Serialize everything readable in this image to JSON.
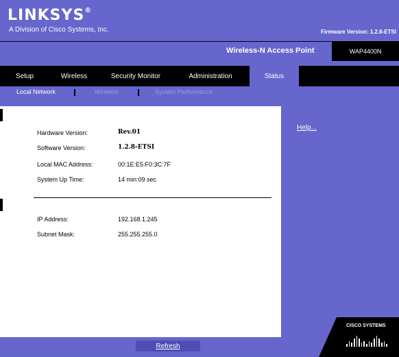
{
  "brand": {
    "name": "LINKSYS",
    "registered": "®",
    "tagline": "A Division of Cisco Systems, Inc."
  },
  "firmware": "Firmware Version: 1.2.8-ETSI",
  "product_name": "Wireless-N Access Point",
  "model": "WAP4400N",
  "tabs": [
    {
      "label": "Setup"
    },
    {
      "label": "Wireless"
    },
    {
      "label": "Security Monitor"
    },
    {
      "label": "Administration"
    },
    {
      "label": "Status"
    }
  ],
  "subtabs": [
    {
      "label": "Local Network"
    },
    {
      "label": "Wireless"
    },
    {
      "label": "System Performance"
    }
  ],
  "info": {
    "hardware_label": "Hardware Version:",
    "hardware_value": "Rev.01",
    "software_label": "Software Version:",
    "software_value": "1.2.8-ETSI",
    "mac_label": "Local MAC Address:",
    "mac_value": "00:1E:E5:F0:3C:7F",
    "uptime_label": "System Up Time:",
    "uptime_value": "14 min:09 sec",
    "ip_label": "IP Address:",
    "ip_value": "192.168.1.245",
    "mask_label": "Subnet Mask:",
    "mask_value": "255.255.255.0"
  },
  "help_link": "Help...",
  "refresh_button": "Refresh",
  "cisco_logo": "CISCO SYSTEMS",
  "colors": {
    "brand_purple": "#6666cc",
    "black": "#000000",
    "white": "#ffffff"
  }
}
